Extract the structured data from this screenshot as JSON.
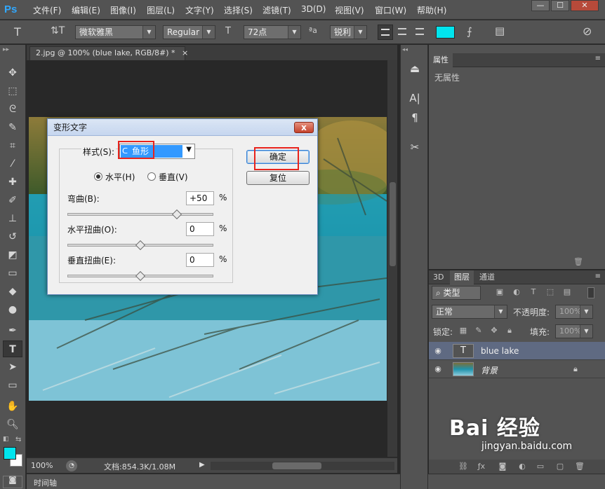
{
  "app": {
    "logo": "Ps"
  },
  "menu": [
    "文件(F)",
    "编辑(E)",
    "图像(I)",
    "图层(L)",
    "文字(Y)",
    "选择(S)",
    "滤镜(T)",
    "3D(D)",
    "视图(V)",
    "窗口(W)",
    "帮助(H)"
  ],
  "window_buttons": {
    "minimize": "—",
    "restore": "☐",
    "close": "✕"
  },
  "options": {
    "font_family": "微软雅黑",
    "font_style": "Regular",
    "font_size": "72点",
    "aa_label": "ªa",
    "antialias": "锐利",
    "color": "#00e5ee"
  },
  "document": {
    "tab_title": "2.jpg @ 100% (blue lake, RGB/8#) *",
    "tab_close": "×"
  },
  "status": {
    "zoom": "100%",
    "doc_info": "文档:854.3K/1.08M"
  },
  "timeline": {
    "label": "时间轴"
  },
  "colors": {
    "foreground": "#00e5ee",
    "background": "#ffffff",
    "dialog_highlight": "#3399ff"
  },
  "dialog": {
    "title": "变形文字",
    "close": "x",
    "style_label": "样式(S):",
    "style_value": "鱼形",
    "horizontal_label": "水平(H)",
    "vertical_label": "垂直(V)",
    "orientation": "horizontal",
    "bend_label": "弯曲(B):",
    "bend_value": "+50",
    "hdistort_label": "水平扭曲(O):",
    "hdistort_value": "0",
    "vdistort_label": "垂直扭曲(E):",
    "vdistort_value": "0",
    "percent": "%",
    "ok_label": "确定",
    "reset_label": "复位",
    "bend_level": 50,
    "hdistort_level": 0,
    "vdistort_level": 0
  },
  "properties_panel": {
    "tab": "属性",
    "content": "无属性"
  },
  "layers_panel": {
    "tabs": [
      "3D",
      "图层",
      "通道"
    ],
    "filter_kind": "类型",
    "blend_mode": "正常",
    "opacity_label": "不透明度:",
    "opacity_value": "100%",
    "lock_label": "锁定:",
    "fill_label": "填充:",
    "fill_value": "100%",
    "layers": [
      {
        "name": "blue  lake",
        "type": "text",
        "thumb": "T"
      },
      {
        "name": "背景",
        "type": "image"
      }
    ]
  },
  "watermark": {
    "main": "Bai 经验",
    "sub": "jingyan.baidu.com"
  }
}
